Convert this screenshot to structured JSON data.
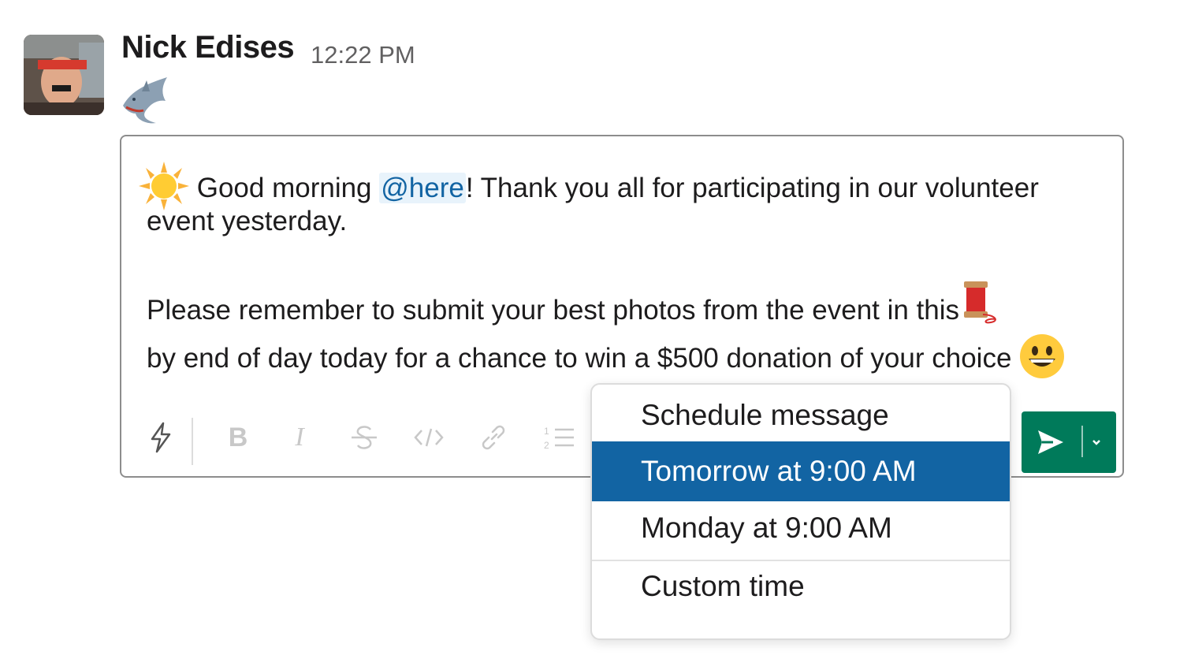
{
  "message": {
    "author": "Nick Edises",
    "timestamp": "12:22 PM",
    "status_emoji": "shark-emoji"
  },
  "composer": {
    "line1_before": "Good morning ",
    "mention": "@here",
    "line1_after": "! Thank you all for participating in our volunteer",
    "line2": "event yesterday.",
    "line3": "Please remember to submit your best photos from the event in this",
    "line4": "by end of day today for a chance to win a $500 donation of your choice",
    "emojis": [
      "sun-emoji",
      "thread-emoji",
      "grinning-emoji"
    ]
  },
  "toolbar": {
    "icons": [
      "shortcuts-icon",
      "bold-icon",
      "italic-icon",
      "strikethrough-icon",
      "code-icon",
      "link-icon",
      "ordered-list-icon"
    ],
    "bold_label": "B",
    "italic_label": "I"
  },
  "send": {
    "icons": [
      "send-icon",
      "chevron-down-icon"
    ],
    "accent": "#007a5a"
  },
  "schedule_menu": {
    "title": "Schedule message",
    "items": [
      {
        "label": "Tomorrow at 9:00 AM",
        "selected": true
      },
      {
        "label": "Monday at 9:00 AM",
        "selected": false
      },
      {
        "label": "Custom time",
        "selected": false
      }
    ],
    "highlight_color": "#1264a3"
  }
}
